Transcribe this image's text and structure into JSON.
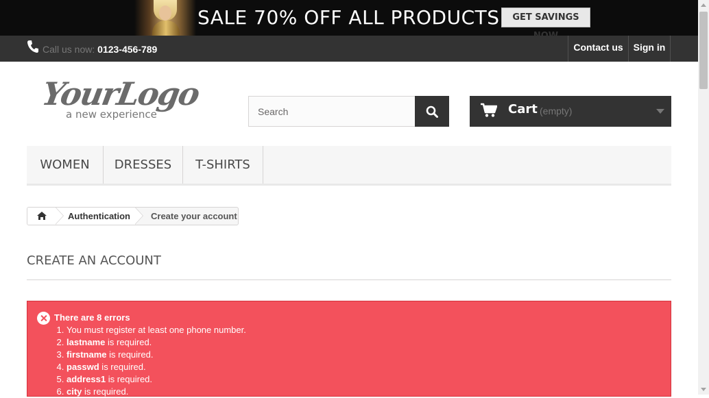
{
  "banner": {
    "headline": "SALE 70% OFF ALL PRODUCTS",
    "cta_label": "GET SAVINGS NOW"
  },
  "topnav": {
    "phone_label": "Call us now:",
    "phone_number": "0123-456-789",
    "contact_label": "Contact us",
    "signin_label": "Sign in"
  },
  "logo": {
    "script_text": "YourLogo",
    "tagline": "a new experience"
  },
  "search": {
    "placeholder": "Search",
    "icon": "search-icon"
  },
  "cart": {
    "label": "Cart",
    "status": "(empty)",
    "icon": "cart-icon"
  },
  "menu": {
    "items": [
      {
        "label": "WOMEN"
      },
      {
        "label": "DRESSES"
      },
      {
        "label": "T-SHIRTS"
      }
    ]
  },
  "breadcrumb": {
    "home_icon": "home-icon",
    "items": [
      {
        "label": "Authentication"
      },
      {
        "label": "Create your account"
      }
    ]
  },
  "page": {
    "title": "CREATE AN ACCOUNT"
  },
  "errors": {
    "heading": "There are 8 errors",
    "items": [
      {
        "field": "",
        "message": "You must register at least one phone number."
      },
      {
        "field": "lastname",
        "message": " is required."
      },
      {
        "field": "firstname",
        "message": " is required."
      },
      {
        "field": "passwd",
        "message": " is required."
      },
      {
        "field": "address1",
        "message": " is required."
      },
      {
        "field": "city",
        "message": " is required."
      }
    ]
  },
  "colors": {
    "dark": "#333333",
    "error_bg": "#f3515c",
    "border": "#d6d4d4"
  }
}
